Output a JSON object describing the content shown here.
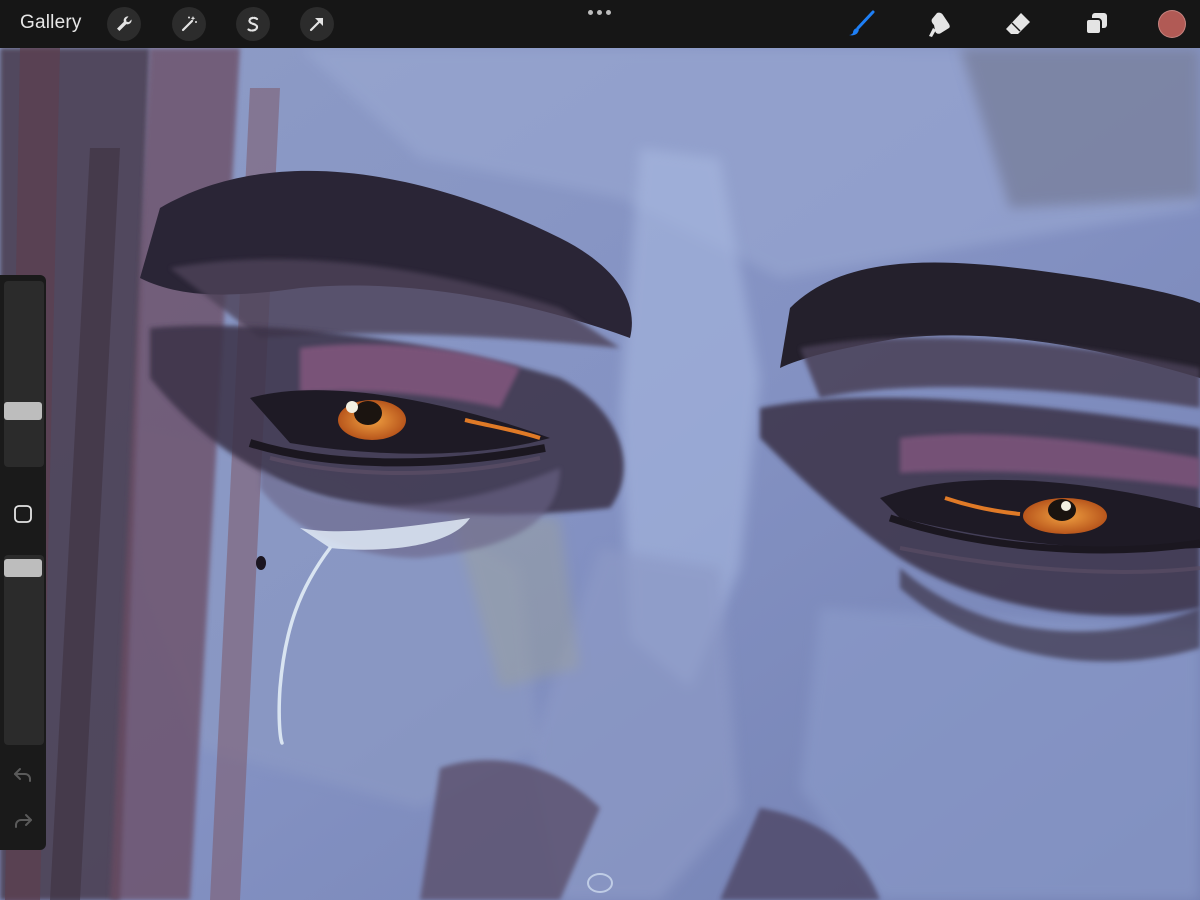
{
  "topbar": {
    "gallery_label": "Gallery",
    "left_tools": [
      "wrench-icon",
      "magic-wand-icon",
      "selection-s-icon",
      "transform-arrow-icon"
    ],
    "right_tools": [
      "brush-icon",
      "smudge-icon",
      "eraser-icon",
      "layers-icon"
    ],
    "active_tool": "brush-icon",
    "accent_color": "#1e7ff5",
    "current_color": "#b15a55"
  },
  "sidebar": {
    "brush_size_level": 0.33,
    "opacity_level": 0.92,
    "modify_icon": "square-icon",
    "undo_icon": "undo-icon",
    "redo_icon": "redo-icon"
  },
  "canvas": {
    "subject": "painting",
    "palette": [
      "#7e8bb8",
      "#2a2435",
      "#6f4f6e",
      "#e07a27",
      "#c9d7ec"
    ]
  }
}
